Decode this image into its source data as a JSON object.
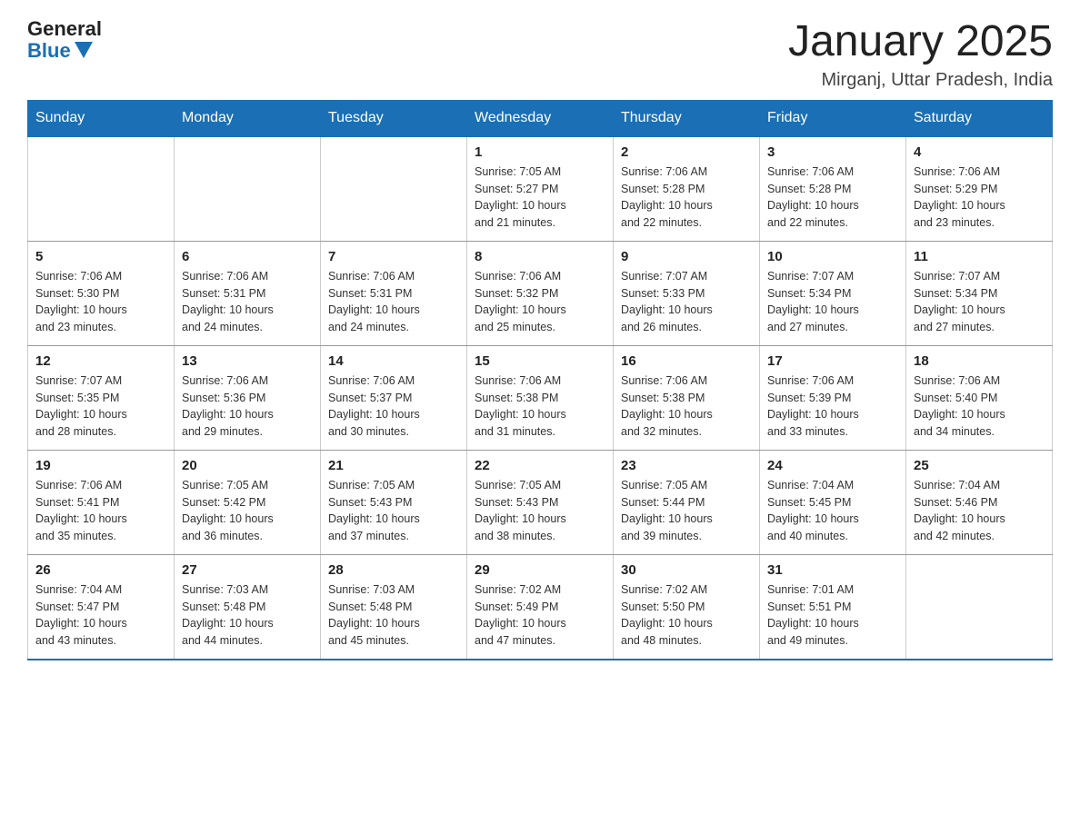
{
  "header": {
    "logo_general": "General",
    "logo_blue": "Blue",
    "month_title": "January 2025",
    "subtitle": "Mirganj, Uttar Pradesh, India"
  },
  "days_of_week": [
    "Sunday",
    "Monday",
    "Tuesday",
    "Wednesday",
    "Thursday",
    "Friday",
    "Saturday"
  ],
  "weeks": [
    [
      {
        "day": "",
        "info": ""
      },
      {
        "day": "",
        "info": ""
      },
      {
        "day": "",
        "info": ""
      },
      {
        "day": "1",
        "info": "Sunrise: 7:05 AM\nSunset: 5:27 PM\nDaylight: 10 hours\nand 21 minutes."
      },
      {
        "day": "2",
        "info": "Sunrise: 7:06 AM\nSunset: 5:28 PM\nDaylight: 10 hours\nand 22 minutes."
      },
      {
        "day": "3",
        "info": "Sunrise: 7:06 AM\nSunset: 5:28 PM\nDaylight: 10 hours\nand 22 minutes."
      },
      {
        "day": "4",
        "info": "Sunrise: 7:06 AM\nSunset: 5:29 PM\nDaylight: 10 hours\nand 23 minutes."
      }
    ],
    [
      {
        "day": "5",
        "info": "Sunrise: 7:06 AM\nSunset: 5:30 PM\nDaylight: 10 hours\nand 23 minutes."
      },
      {
        "day": "6",
        "info": "Sunrise: 7:06 AM\nSunset: 5:31 PM\nDaylight: 10 hours\nand 24 minutes."
      },
      {
        "day": "7",
        "info": "Sunrise: 7:06 AM\nSunset: 5:31 PM\nDaylight: 10 hours\nand 24 minutes."
      },
      {
        "day": "8",
        "info": "Sunrise: 7:06 AM\nSunset: 5:32 PM\nDaylight: 10 hours\nand 25 minutes."
      },
      {
        "day": "9",
        "info": "Sunrise: 7:07 AM\nSunset: 5:33 PM\nDaylight: 10 hours\nand 26 minutes."
      },
      {
        "day": "10",
        "info": "Sunrise: 7:07 AM\nSunset: 5:34 PM\nDaylight: 10 hours\nand 27 minutes."
      },
      {
        "day": "11",
        "info": "Sunrise: 7:07 AM\nSunset: 5:34 PM\nDaylight: 10 hours\nand 27 minutes."
      }
    ],
    [
      {
        "day": "12",
        "info": "Sunrise: 7:07 AM\nSunset: 5:35 PM\nDaylight: 10 hours\nand 28 minutes."
      },
      {
        "day": "13",
        "info": "Sunrise: 7:06 AM\nSunset: 5:36 PM\nDaylight: 10 hours\nand 29 minutes."
      },
      {
        "day": "14",
        "info": "Sunrise: 7:06 AM\nSunset: 5:37 PM\nDaylight: 10 hours\nand 30 minutes."
      },
      {
        "day": "15",
        "info": "Sunrise: 7:06 AM\nSunset: 5:38 PM\nDaylight: 10 hours\nand 31 minutes."
      },
      {
        "day": "16",
        "info": "Sunrise: 7:06 AM\nSunset: 5:38 PM\nDaylight: 10 hours\nand 32 minutes."
      },
      {
        "day": "17",
        "info": "Sunrise: 7:06 AM\nSunset: 5:39 PM\nDaylight: 10 hours\nand 33 minutes."
      },
      {
        "day": "18",
        "info": "Sunrise: 7:06 AM\nSunset: 5:40 PM\nDaylight: 10 hours\nand 34 minutes."
      }
    ],
    [
      {
        "day": "19",
        "info": "Sunrise: 7:06 AM\nSunset: 5:41 PM\nDaylight: 10 hours\nand 35 minutes."
      },
      {
        "day": "20",
        "info": "Sunrise: 7:05 AM\nSunset: 5:42 PM\nDaylight: 10 hours\nand 36 minutes."
      },
      {
        "day": "21",
        "info": "Sunrise: 7:05 AM\nSunset: 5:43 PM\nDaylight: 10 hours\nand 37 minutes."
      },
      {
        "day": "22",
        "info": "Sunrise: 7:05 AM\nSunset: 5:43 PM\nDaylight: 10 hours\nand 38 minutes."
      },
      {
        "day": "23",
        "info": "Sunrise: 7:05 AM\nSunset: 5:44 PM\nDaylight: 10 hours\nand 39 minutes."
      },
      {
        "day": "24",
        "info": "Sunrise: 7:04 AM\nSunset: 5:45 PM\nDaylight: 10 hours\nand 40 minutes."
      },
      {
        "day": "25",
        "info": "Sunrise: 7:04 AM\nSunset: 5:46 PM\nDaylight: 10 hours\nand 42 minutes."
      }
    ],
    [
      {
        "day": "26",
        "info": "Sunrise: 7:04 AM\nSunset: 5:47 PM\nDaylight: 10 hours\nand 43 minutes."
      },
      {
        "day": "27",
        "info": "Sunrise: 7:03 AM\nSunset: 5:48 PM\nDaylight: 10 hours\nand 44 minutes."
      },
      {
        "day": "28",
        "info": "Sunrise: 7:03 AM\nSunset: 5:48 PM\nDaylight: 10 hours\nand 45 minutes."
      },
      {
        "day": "29",
        "info": "Sunrise: 7:02 AM\nSunset: 5:49 PM\nDaylight: 10 hours\nand 47 minutes."
      },
      {
        "day": "30",
        "info": "Sunrise: 7:02 AM\nSunset: 5:50 PM\nDaylight: 10 hours\nand 48 minutes."
      },
      {
        "day": "31",
        "info": "Sunrise: 7:01 AM\nSunset: 5:51 PM\nDaylight: 10 hours\nand 49 minutes."
      },
      {
        "day": "",
        "info": ""
      }
    ]
  ]
}
